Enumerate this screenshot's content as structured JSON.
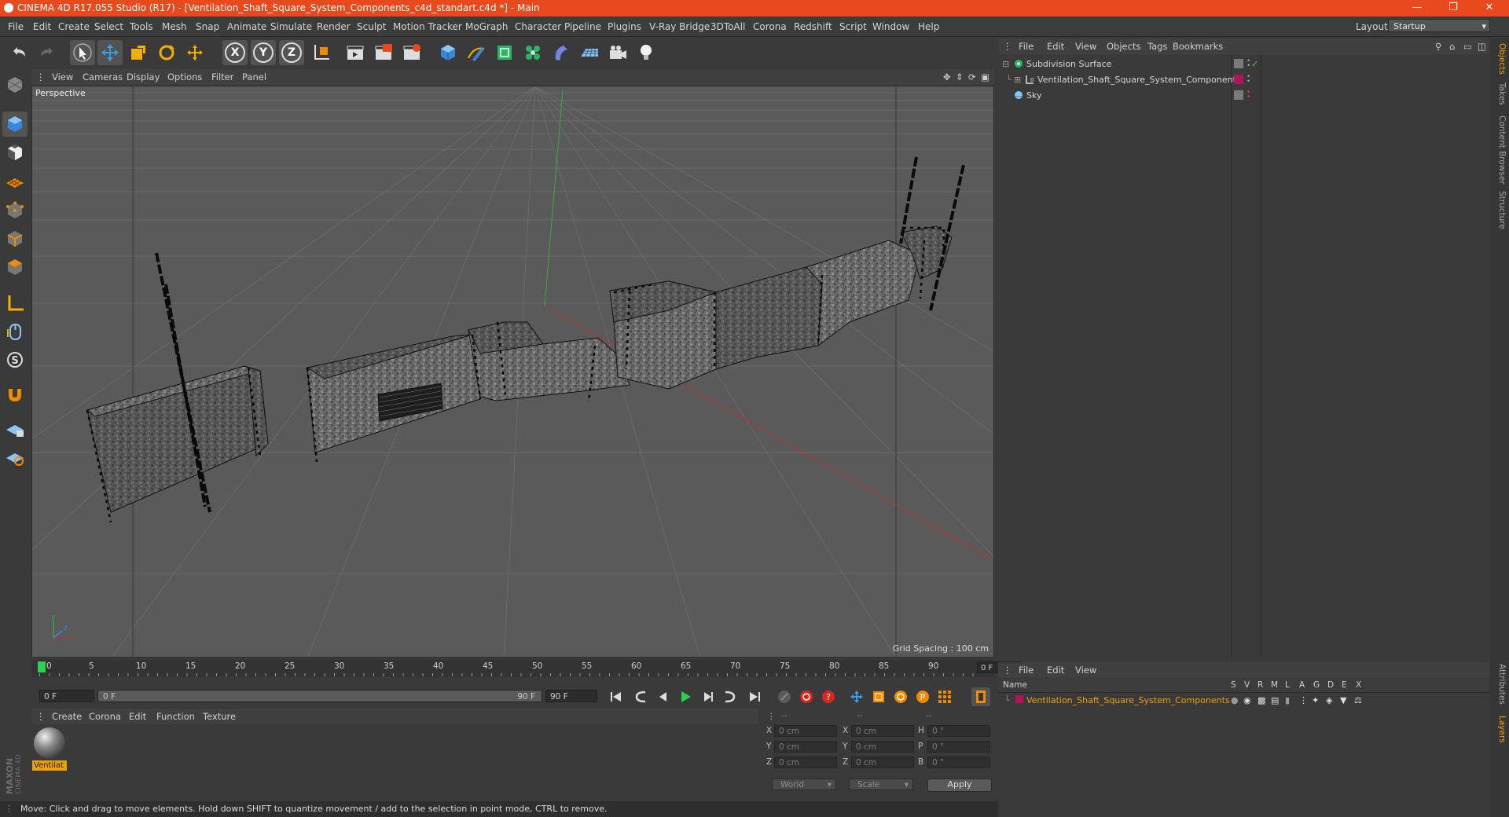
{
  "titlebar": {
    "title": "CINEMA 4D R17.055 Studio (R17) - [Ventilation_Shaft_Square_System_Components_c4d_standart.c4d *] - Main",
    "minimize": "—",
    "restore": "❐",
    "close": "✕"
  },
  "menu": [
    "File",
    "Edit",
    "Create",
    "Select",
    "Tools",
    "Mesh",
    "Snap",
    "Animate",
    "Simulate",
    "Render",
    "Sculpt",
    "Motion Tracker",
    "MoGraph",
    "Character",
    "Pipeline",
    "Plugins",
    "V-Ray Bridge",
    "3DToAll",
    "Corona",
    "Redshift",
    "Script",
    "Window",
    "Help"
  ],
  "layout": {
    "label": "Layout:",
    "value": "Startup"
  },
  "toolbar": {
    "axis_x": "X",
    "axis_y": "Y",
    "axis_z": "Z"
  },
  "viewport": {
    "menu": [
      "View",
      "Cameras",
      "Display",
      "Options",
      "Filter",
      "Panel"
    ],
    "camera": "Perspective",
    "grid_spacing": "Grid Spacing : 100 cm"
  },
  "timeline": {
    "ticks": [
      "0",
      "5",
      "10",
      "15",
      "20",
      "25",
      "30",
      "35",
      "40",
      "45",
      "50",
      "55",
      "60",
      "65",
      "70",
      "75",
      "80",
      "85",
      "90"
    ],
    "current_frame": "0 F",
    "start_field": "0 F",
    "range_start": "0 F",
    "range_end": "90 F",
    "end_field": "90 F",
    "playhead_frame": 0
  },
  "material_manager": {
    "menu": [
      "Create",
      "Corona",
      "Edit",
      "Function",
      "Texture"
    ],
    "material_name": "Ventilat"
  },
  "coordinates": {
    "headers": [
      "--",
      "--",
      "--"
    ],
    "rows": [
      {
        "l1": "X",
        "v1": "0 cm",
        "l2": "X",
        "v2": "0 cm",
        "l3": "H",
        "v3": "0 °"
      },
      {
        "l1": "Y",
        "v1": "0 cm",
        "l2": "Y",
        "v2": "0 cm",
        "l3": "P",
        "v3": "0 °"
      },
      {
        "l1": "Z",
        "v1": "0 cm",
        "l2": "Z",
        "v2": "0 cm",
        "l3": "B",
        "v3": "0 °"
      }
    ],
    "world": "World",
    "scale": "Scale",
    "apply": "Apply"
  },
  "status": "Move: Click and drag to move elements. Hold down SHIFT to quantize movement / add to the selection in point mode, CTRL to remove.",
  "object_manager": {
    "menu": [
      "File",
      "Edit",
      "View",
      "Objects",
      "Tags",
      "Bookmarks"
    ],
    "objects": [
      {
        "name": "Subdivision Surface"
      },
      {
        "name": "Ventilation_Shaft_Square_System_Components"
      },
      {
        "name": "Sky"
      }
    ]
  },
  "layer_manager": {
    "menu": [
      "File",
      "Edit",
      "View"
    ],
    "columns": [
      "Name",
      "S",
      "V",
      "R",
      "M",
      "L",
      "A",
      "G",
      "D",
      "E",
      "X"
    ],
    "layers": [
      {
        "name": "Ventilation_Shaft_Square_System_Components",
        "color": "#b0155a"
      }
    ]
  },
  "right_tabs": [
    "Objects",
    "Takes",
    "Content Browser",
    "Structure",
    "Attributes",
    "Layers"
  ],
  "colors": {
    "accent": "#e8491d",
    "highlight": "#f0a000",
    "active_blue": "#3a86d8"
  }
}
